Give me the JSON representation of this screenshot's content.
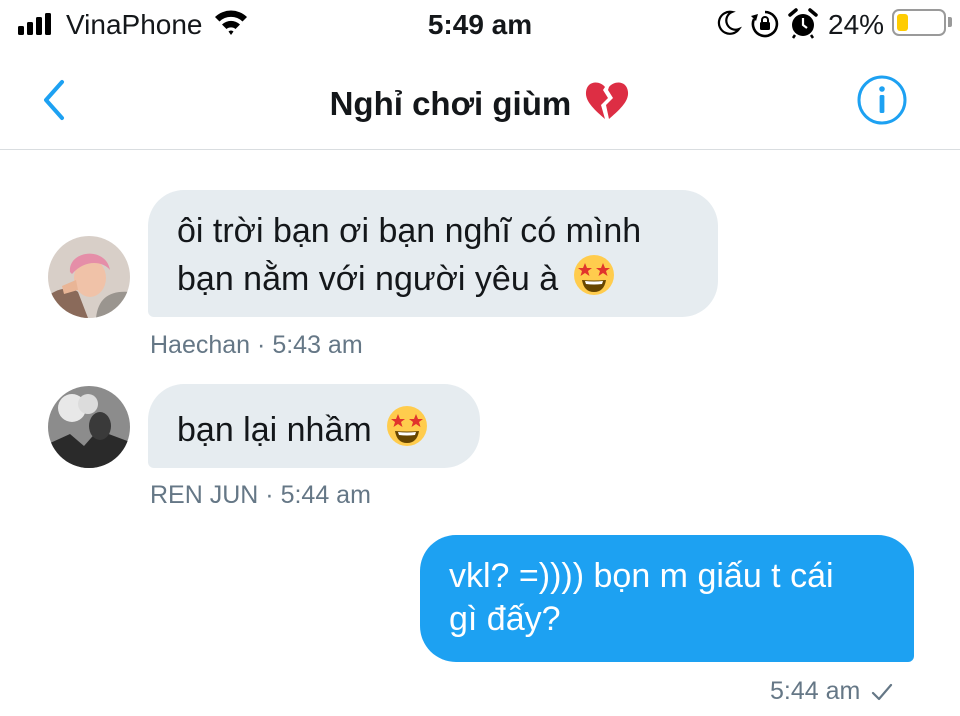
{
  "status_bar": {
    "carrier": "VinaPhone",
    "time": "5:49 am",
    "battery_percent": "24%",
    "battery_level": 0.24,
    "icons": [
      "signal-icon",
      "wifi-icon",
      "moon-icon",
      "rotation-lock-icon",
      "alarm-icon",
      "battery-icon"
    ]
  },
  "nav": {
    "title": "Nghỉ chơi giùm",
    "title_emoji": "💔",
    "back_icon": "chevron-left-icon",
    "info_icon": "info-icon"
  },
  "messages": [
    {
      "direction": "incoming",
      "text_line1": "ôi trời bạn ơi bạn nghĩ có mình",
      "text_line2": "bạn nằm với người yêu à",
      "emoji": "🤩",
      "sender": "Haechan",
      "separator": "·",
      "time": "5:43 am"
    },
    {
      "direction": "incoming",
      "text_line1": "bạn lại nhầm",
      "emoji": "🤩",
      "sender": "REN JUN",
      "separator": "·",
      "time": "5:44 am"
    },
    {
      "direction": "outgoing",
      "text_line1": "vkl? =)))) bọn m giấu t cái",
      "text_line2": "gì đấy?",
      "time": "5:44 am",
      "status_icon": "checkmark-icon"
    }
  ],
  "colors": {
    "accent": "#1da1f2",
    "incoming_bubble": "#e6ecf0",
    "meta_text": "#657786",
    "battery": "#ffcc00"
  }
}
